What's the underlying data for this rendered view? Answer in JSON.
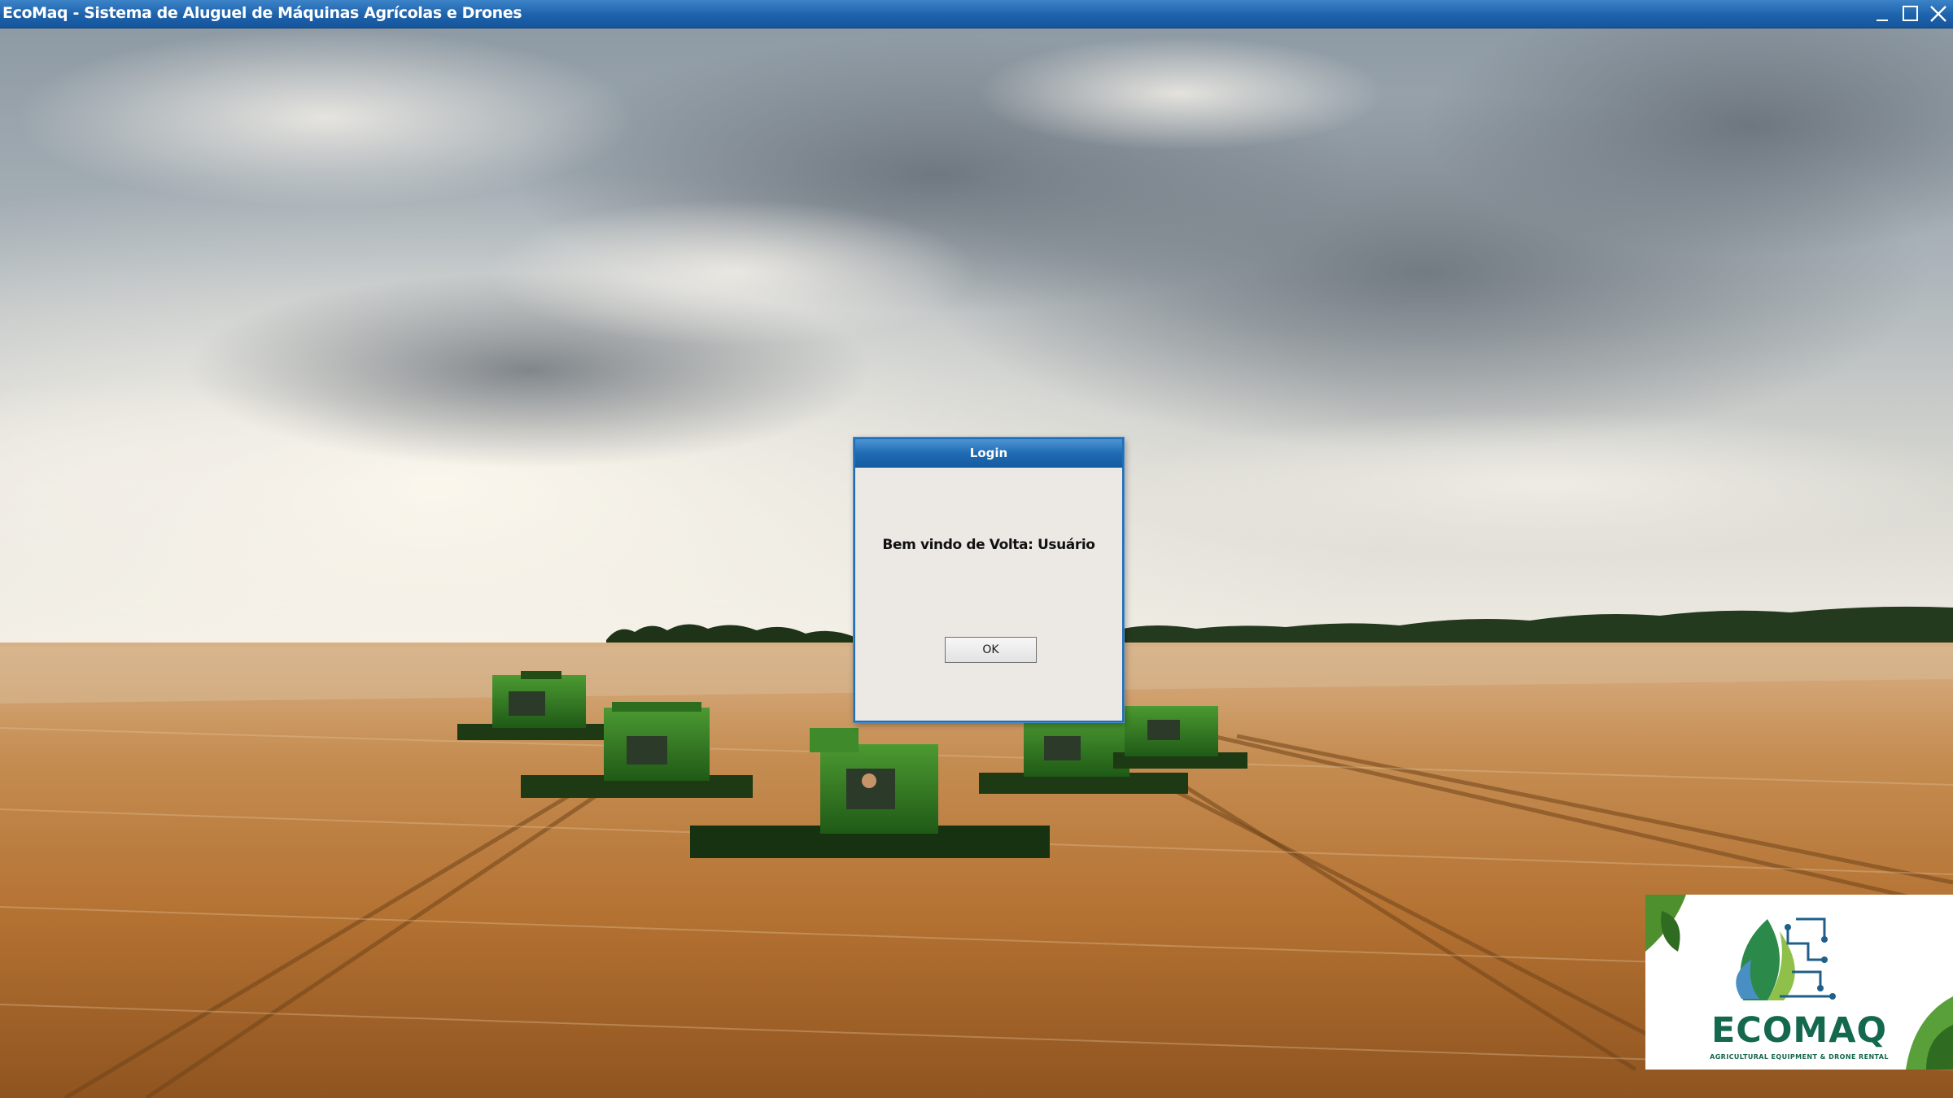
{
  "window": {
    "title": "EcoMaq - Sistema de Aluguel de Máquinas Agrícolas e Drones",
    "controls": [
      "minimize-icon",
      "maximize-icon",
      "close-icon"
    ]
  },
  "background": {
    "description_icon": "wheat-field-with-combine-harvesters-image"
  },
  "dialog": {
    "title": "Login",
    "message": "Bem vindo de Volta: Usuário",
    "ok_label": "OK"
  },
  "logo": {
    "brand": "ECOMAQ",
    "tagline": "AGRICULTURAL EQUIPMENT & DRONE RENTAL"
  },
  "colors": {
    "titlebar": "#1d62ab",
    "dialog_bg": "#ece9e5",
    "brand_green": "#14684d",
    "harvester_green": "#2f7d22"
  }
}
